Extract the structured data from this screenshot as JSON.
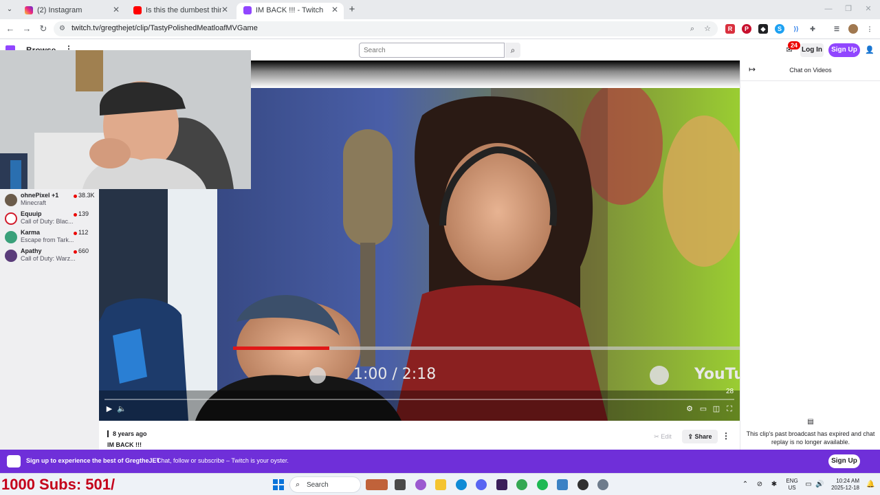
{
  "browser": {
    "tabs": [
      {
        "title": "(2) Instagram",
        "active": false
      },
      {
        "title": "Is this the dumbest thing you e",
        "active": false
      },
      {
        "title": "IM BACK !!! - Twitch",
        "active": true
      }
    ],
    "url": "twitch.tv/gregthejet/clip/TastyPolishedMeatloafMVGame"
  },
  "twitch": {
    "nav": {
      "browse": "Browse",
      "search_placeholder": "Search",
      "notification_count": "24",
      "login_label": "Log In",
      "signup_label": "Sign Up"
    },
    "sidebar": {
      "channels": [
        {
          "name": "ohnePixel +1",
          "game": "Minecraft",
          "viewers": "38.3K",
          "color": "#6b5b4a"
        },
        {
          "name": "Equuip",
          "game": "Call of Duty: Blac...",
          "viewers": "139",
          "color": "#d11a2a"
        },
        {
          "name": "Karma",
          "game": "Escape from Tark...",
          "viewers": "112",
          "color": "#3aa07a"
        },
        {
          "name": "Apathy",
          "game": "Call of Duty: Warz...",
          "viewers": "660",
          "color": "#5a3c7a"
        }
      ]
    },
    "player": {
      "embedded_time": "1:00 / 2:18",
      "embedded_logo": "YouTube",
      "views": "28"
    },
    "clip": {
      "age": "8 years ago",
      "title": "IM BACK !!!",
      "edit_label": "Edit",
      "share_label": "Share"
    },
    "chat": {
      "title": "Chat on Videos",
      "message": "This clip's past broadcast has expired and chat replay is no longer available."
    },
    "banner": {
      "headline": "Sign up to experience the best of GregtheJET",
      "text": "Chat, follow or subscribe – Twitch is your oyster.",
      "signup_label": "Sign Up"
    }
  },
  "taskbar": {
    "overlay_text": "1000 Subs: 501/",
    "search_label": "Search",
    "lang_primary": "ENG",
    "lang_secondary": "US",
    "time": "10:24 AM",
    "date": "2025-12-18"
  },
  "colors": {
    "twitch_purple": "#9146ff",
    "banner_purple": "#6f2fd9",
    "live_red": "#eb0400"
  }
}
